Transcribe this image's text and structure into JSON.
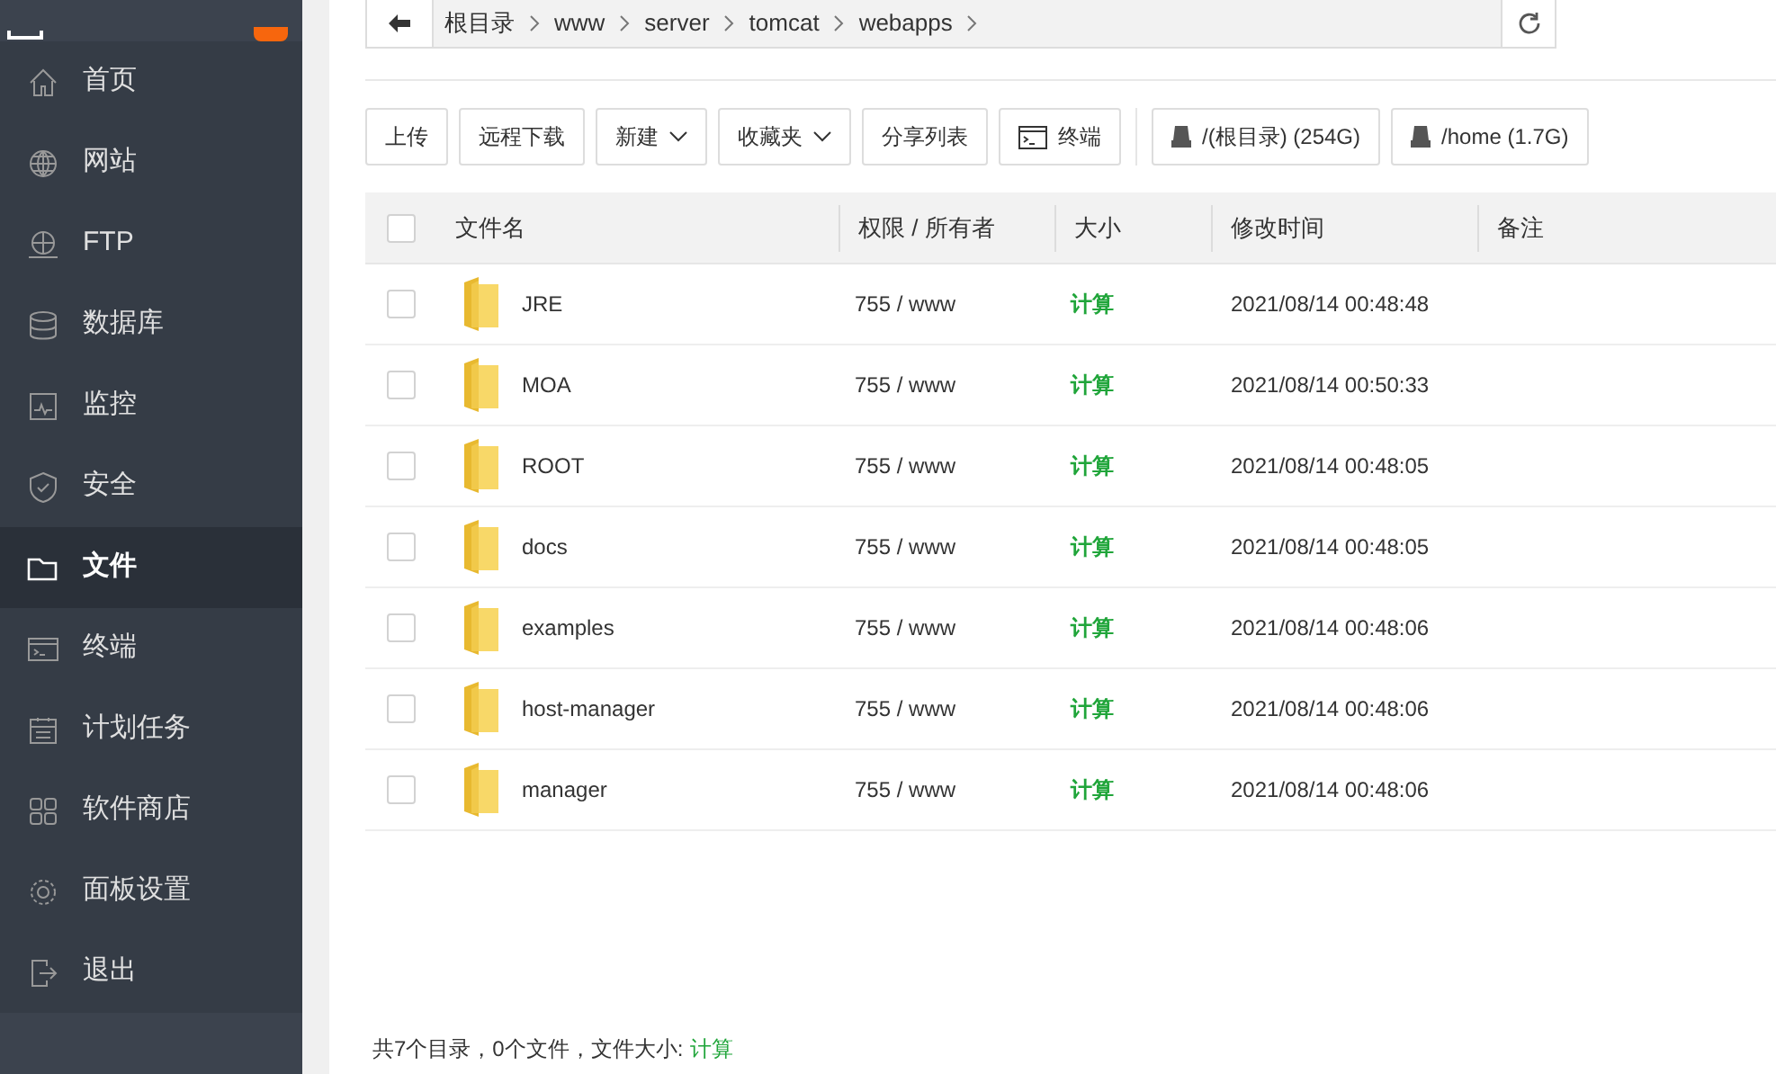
{
  "sidebar": {
    "items": [
      {
        "label": "首页",
        "selected": false
      },
      {
        "label": "网站",
        "selected": false
      },
      {
        "label": "FTP",
        "selected": false
      },
      {
        "label": "数据库",
        "selected": false
      },
      {
        "label": "监控",
        "selected": false
      },
      {
        "label": "安全",
        "selected": false
      },
      {
        "label": "文件",
        "selected": true
      },
      {
        "label": "终端",
        "selected": false
      },
      {
        "label": "计划任务",
        "selected": false
      },
      {
        "label": "软件商店",
        "selected": false
      },
      {
        "label": "面板设置",
        "selected": false
      },
      {
        "label": "退出",
        "selected": false
      }
    ]
  },
  "breadcrumb": [
    "根目录",
    "www",
    "server",
    "tomcat",
    "webapps"
  ],
  "toolbar": [
    {
      "label": "上传",
      "kind": "plain"
    },
    {
      "label": "远程下载",
      "kind": "plain"
    },
    {
      "label": "新建",
      "kind": "dropdown"
    },
    {
      "label": "收藏夹",
      "kind": "dropdown"
    },
    {
      "label": "分享列表",
      "kind": "plain"
    },
    {
      "label": "终端",
      "kind": "terminal"
    },
    {
      "label": "/(根目录) (254G)",
      "kind": "disk"
    },
    {
      "label": "/home (1.7G)",
      "kind": "disk"
    }
  ],
  "table": {
    "all_checked": false,
    "columns": [
      "文件名",
      "权限 / 所有者",
      "大小",
      "修改时间",
      "备注"
    ],
    "rows": [
      {
        "name": "JRE",
        "perm": "755 / www",
        "size": "计算",
        "modified": "2021/08/14 00:48:48",
        "checked": false
      },
      {
        "name": "MOA",
        "perm": "755 / www",
        "size": "计算",
        "modified": "2021/08/14 00:50:33",
        "checked": false
      },
      {
        "name": "ROOT",
        "perm": "755 / www",
        "size": "计算",
        "modified": "2021/08/14 00:48:05",
        "checked": false
      },
      {
        "name": "docs",
        "perm": "755 / www",
        "size": "计算",
        "modified": "2021/08/14 00:48:05",
        "checked": false
      },
      {
        "name": "examples",
        "perm": "755 / www",
        "size": "计算",
        "modified": "2021/08/14 00:48:06",
        "checked": false
      },
      {
        "name": "host-manager",
        "perm": "755 / www",
        "size": "计算",
        "modified": "2021/08/14 00:48:06",
        "checked": false
      },
      {
        "name": "manager",
        "perm": "755 / www",
        "size": "计算",
        "modified": "2021/08/14 00:48:06",
        "checked": false
      }
    ]
  },
  "footer": {
    "summary": "共7个目录，0个文件，文件大小:",
    "size_link": "计算"
  }
}
